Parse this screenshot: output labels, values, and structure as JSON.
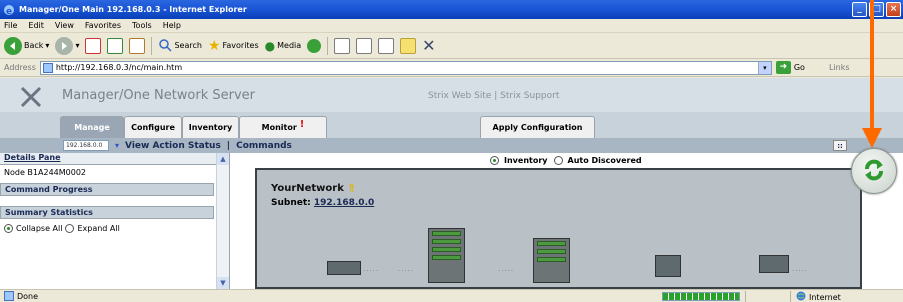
{
  "window": {
    "title": "Manager/One Main 192.168.0.3 - Internet Explorer",
    "min": "_",
    "max": "□",
    "close": "×"
  },
  "menu": [
    "File",
    "Edit",
    "View",
    "Favorites",
    "Tools",
    "Help"
  ],
  "toolbar": {
    "back": "Back",
    "search": "Search",
    "favorites": "Favorites",
    "media": "Media"
  },
  "address": {
    "label": "Address",
    "url": "http://192.168.0.3/nc/main.htm",
    "go": "Go",
    "links": "Links"
  },
  "app": {
    "title": "Manager/One Network Server",
    "links": "Strix Web Site  |  Strix Support"
  },
  "tabs": [
    {
      "label": "Manage"
    },
    {
      "label": "Configure"
    },
    {
      "label": "Inventory"
    },
    {
      "label": "Monitor",
      "alert": "!"
    }
  ],
  "apply_button": "Apply Configuration",
  "actionbar": {
    "selected_node": "192.168.0.0",
    "view_action_status": "View Action Status",
    "separator": "|",
    "commands": "Commands",
    "grid_icon": "::"
  },
  "left_pane": {
    "details_head": "Details Pane",
    "node": "Node B1A244M0002",
    "command_progress": "Command Progress",
    "summary_statistics": "Summary Statistics",
    "collapse_all": "Collapse All",
    "expand_all": "Expand All"
  },
  "view_toggle": {
    "inventory": "Inventory",
    "auto_discovered": "Auto Discovered"
  },
  "network": {
    "title": "YourNetwork",
    "subnet_label": "Subnet:",
    "subnet_ip": "192.168.0.0"
  },
  "status": {
    "left": "Done",
    "zone": "Internet",
    "progress_percent": 100
  },
  "colors": {
    "title_bar": "#1a56d6",
    "annotation_arrow": "#ff6a00",
    "refresh_green": "#2f9a2f"
  }
}
